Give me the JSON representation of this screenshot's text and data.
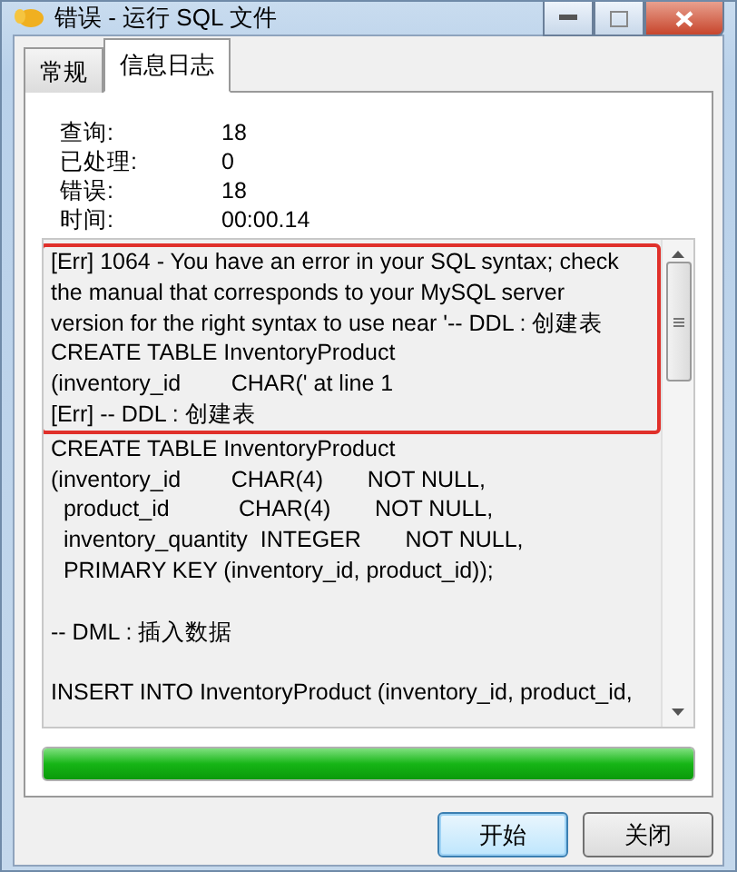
{
  "window": {
    "title": "错误 - 运行 SQL 文件"
  },
  "tabs": [
    {
      "label": "常规",
      "selected": false
    },
    {
      "label": "信息日志",
      "selected": true
    }
  ],
  "stats": [
    {
      "label": "查询:",
      "value": "18"
    },
    {
      "label": "已处理:",
      "value": "0"
    },
    {
      "label": "错误:",
      "value": "18"
    },
    {
      "label": "时间:",
      "value": "00:00.14"
    }
  ],
  "log": {
    "highlighted_lines": [
      "[Err] 1064 - You have an error in your SQL syntax; check",
      "the manual that corresponds to your MySQL server",
      "version for the right syntax to use near '-- DDL : 创建表",
      "CREATE TABLE InventoryProduct",
      "(inventory_id        CHAR(' at line 1",
      "[Err] -- DDL : 创建表"
    ],
    "lines": [
      {
        "text": "CREATE TABLE InventoryProduct",
        "blank_before": false
      },
      {
        "text": "(inventory_id        CHAR(4)       NOT NULL,",
        "blank_before": false
      },
      {
        "text": "  product_id           CHAR(4)       NOT NULL,",
        "blank_before": false
      },
      {
        "text": "  inventory_quantity  INTEGER       NOT NULL,",
        "blank_before": false
      },
      {
        "text": "  PRIMARY KEY (inventory_id, product_id));",
        "blank_before": false
      },
      {
        "text": "-- DML : 插入数据",
        "blank_before": true
      },
      {
        "text": "INSERT INTO InventoryProduct (inventory_id, product_id,",
        "blank_before": true
      }
    ]
  },
  "progress": {
    "level": 1
  },
  "buttons": [
    {
      "label": "开始",
      "default": true
    },
    {
      "label": "关闭",
      "default": false
    }
  ]
}
